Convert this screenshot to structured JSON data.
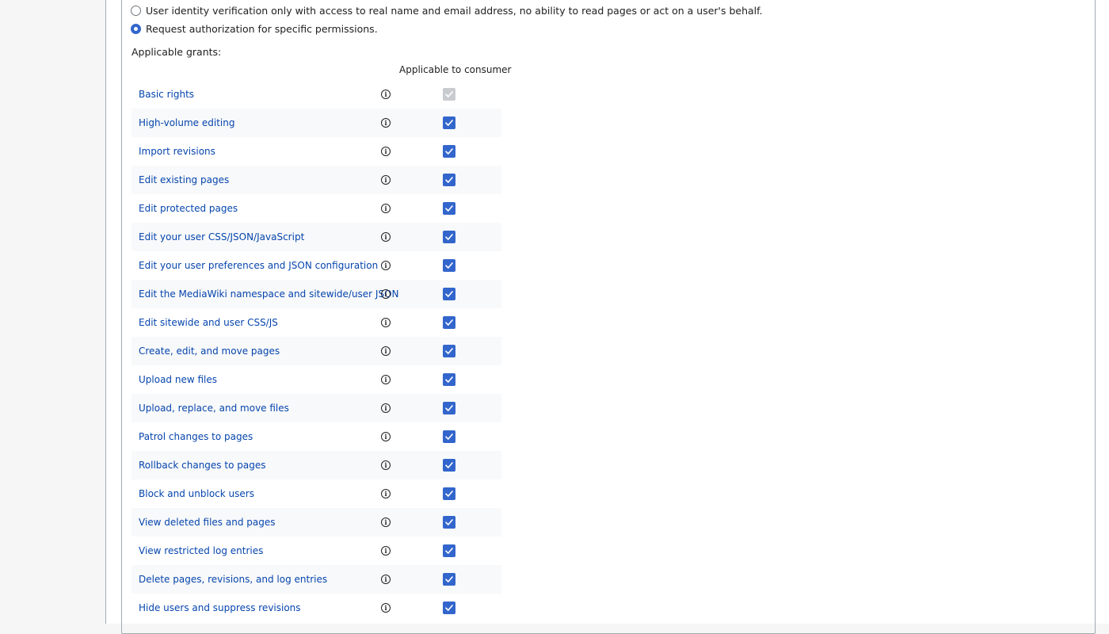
{
  "auth_options": [
    {
      "label": "User identity verification only with access to real name and email address, no ability to read pages or act on a user's behalf.",
      "selected": false
    },
    {
      "label": "Request authorization for specific permissions.",
      "selected": true
    }
  ],
  "applicable_grants_label": "Applicable grants:",
  "column_header": "Applicable to consumer",
  "grants": [
    {
      "name": "Basic rights",
      "checked": true,
      "disabled": true
    },
    {
      "name": "High-volume editing",
      "checked": true,
      "disabled": false
    },
    {
      "name": "Import revisions",
      "checked": true,
      "disabled": false
    },
    {
      "name": "Edit existing pages",
      "checked": true,
      "disabled": false
    },
    {
      "name": "Edit protected pages",
      "checked": true,
      "disabled": false
    },
    {
      "name": "Edit your user CSS/JSON/JavaScript",
      "checked": true,
      "disabled": false
    },
    {
      "name": "Edit your user preferences and JSON configuration",
      "checked": true,
      "disabled": false
    },
    {
      "name": "Edit the MediaWiki namespace and sitewide/user JSON",
      "checked": true,
      "disabled": false
    },
    {
      "name": "Edit sitewide and user CSS/JS",
      "checked": true,
      "disabled": false
    },
    {
      "name": "Create, edit, and move pages",
      "checked": true,
      "disabled": false
    },
    {
      "name": "Upload new files",
      "checked": true,
      "disabled": false
    },
    {
      "name": "Upload, replace, and move files",
      "checked": true,
      "disabled": false
    },
    {
      "name": "Patrol changes to pages",
      "checked": true,
      "disabled": false
    },
    {
      "name": "Rollback changes to pages",
      "checked": true,
      "disabled": false
    },
    {
      "name": "Block and unblock users",
      "checked": true,
      "disabled": false
    },
    {
      "name": "View deleted files and pages",
      "checked": true,
      "disabled": false
    },
    {
      "name": "View restricted log entries",
      "checked": true,
      "disabled": false
    },
    {
      "name": "Delete pages, revisions, and log entries",
      "checked": true,
      "disabled": false
    },
    {
      "name": "Hide users and suppress revisions",
      "checked": true,
      "disabled": false
    }
  ],
  "colors": {
    "link": "#0645ad",
    "accent": "#3366cc",
    "disabled": "#c8ccd1"
  }
}
